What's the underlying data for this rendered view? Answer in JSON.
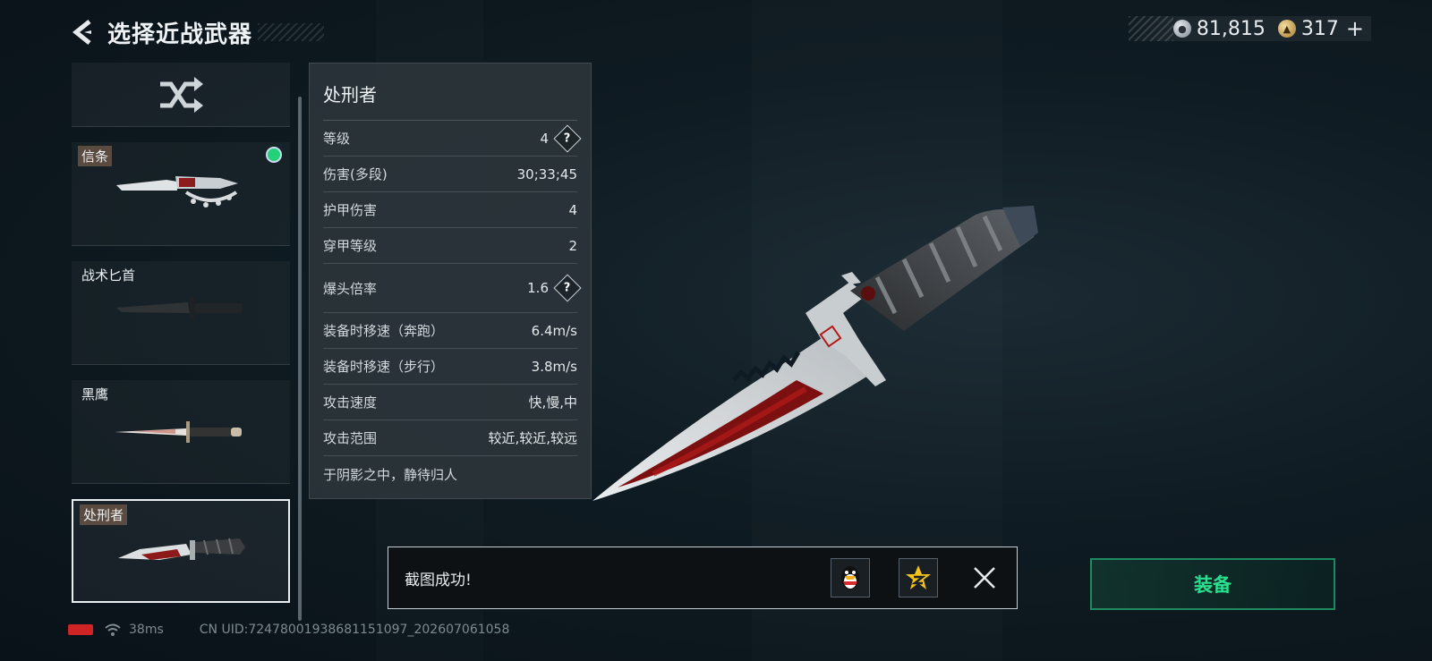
{
  "header": {
    "title": "选择近战武器"
  },
  "currency": [
    {
      "icon": "silver-coin-icon",
      "value": "81,815"
    },
    {
      "icon": "gold-coin-icon",
      "value": "317"
    }
  ],
  "currency_plus": "+",
  "weapons": [
    {
      "name": "信条",
      "equipped": true,
      "selected": false
    },
    {
      "name": "战术匕首",
      "equipped": false,
      "selected": false
    },
    {
      "name": "黑鹰",
      "equipped": false,
      "selected": false
    },
    {
      "name": "处刑者",
      "equipped": false,
      "selected": true
    }
  ],
  "stats": {
    "title": "处刑者",
    "rows": [
      {
        "label": "等级",
        "value": "4",
        "help": true
      },
      {
        "label": "伤害(多段)",
        "value": "30;33;45"
      },
      {
        "label": "护甲伤害",
        "value": "4"
      },
      {
        "label": "穿甲等级",
        "value": "2"
      },
      {
        "label": "爆头倍率",
        "value": "1.6",
        "help": true
      },
      {
        "label": "装备时移速（奔跑）",
        "value": "6.4m/s"
      },
      {
        "label": "装备时移速（步行）",
        "value": "3.8m/s"
      },
      {
        "label": "攻击速度",
        "value": "快,慢,中"
      },
      {
        "label": "攻击范围",
        "value": "较近,较近,较远"
      }
    ],
    "description": "于阴影之中，静待归人"
  },
  "help_glyph": "?",
  "toast": {
    "message": "截图成功!"
  },
  "equip_button": "装备",
  "status_bar": {
    "ping": "38ms",
    "uid": "CN UID:7247800193868115109​7_202607061058"
  },
  "colors": {
    "accent_green": "#28e08e",
    "equipped_dot": "#22d17a",
    "battery": "#d02424"
  }
}
